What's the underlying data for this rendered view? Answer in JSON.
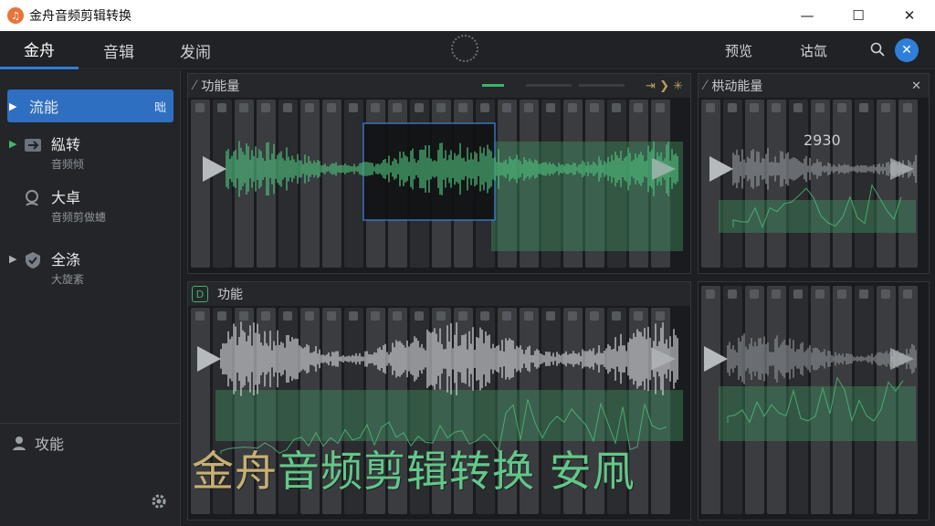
{
  "window": {
    "title": "金舟音频剪辑转换",
    "minimize": "—",
    "maximize": "☐",
    "close": "✕"
  },
  "nav": {
    "tabs": [
      {
        "label": "金舟",
        "active": true
      },
      {
        "label": "音辑",
        "active": false
      },
      {
        "label": "发闹",
        "active": false
      }
    ],
    "right": [
      "预览",
      "诂氙"
    ],
    "close_symbol": "✕"
  },
  "sidebar": {
    "items": [
      {
        "label": "流能",
        "sub": "",
        "badge": "昢",
        "active": true
      },
      {
        "label": "紭转",
        "sub": "音频倾",
        "active": false
      },
      {
        "label": "大卓",
        "sub": "音频剪做蟪",
        "active": false
      },
      {
        "label": "全涤",
        "sub": "大旋紊",
        "active": false
      }
    ],
    "footer_label": "攻能"
  },
  "panels": {
    "top_left": {
      "title": "功能量"
    },
    "top_right": {
      "title": "栱动能量",
      "value": "2930"
    },
    "bottom_left": {
      "title": "功能"
    }
  },
  "watermark": {
    "part1": "金舟",
    "part2": "音频剪辑转换 安凧"
  },
  "colors": {
    "accent": "#2f7ed8",
    "waveform_green": "#4fbf7d",
    "waveform_white": "#d8dadc",
    "brand_orange": "#e8743b"
  }
}
